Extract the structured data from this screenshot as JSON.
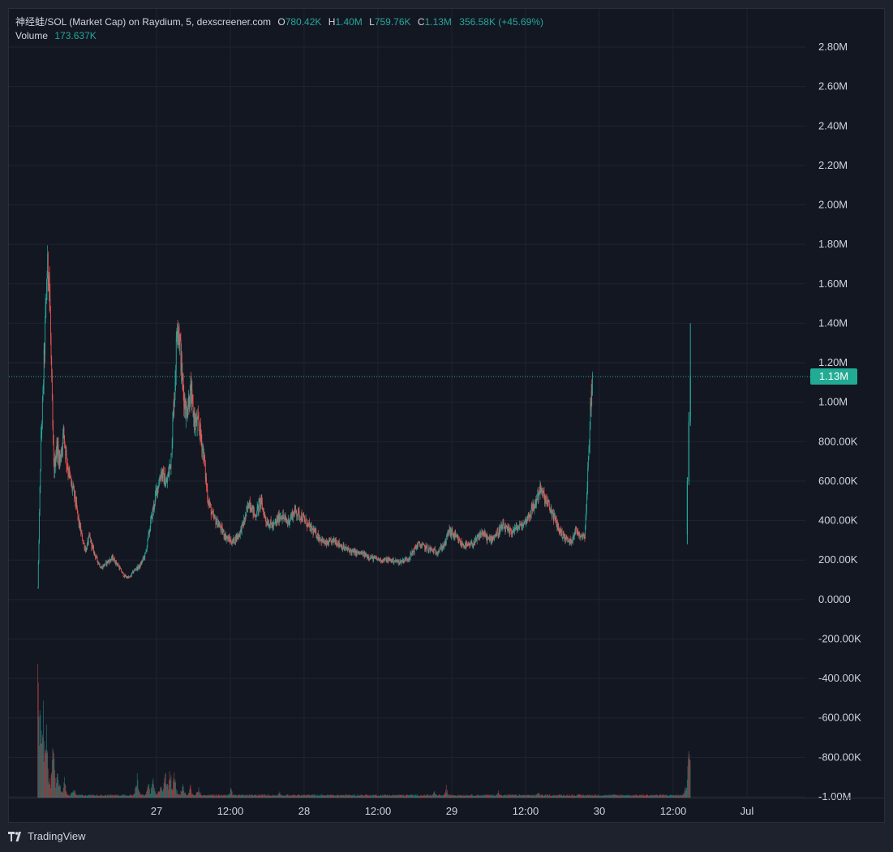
{
  "legend": {
    "symbol": "神经蛙/SOL (Market Cap) on Raydium, 5, dexscreener.com",
    "open_label": "O",
    "open": "780.42K",
    "high_label": "H",
    "high": "1.40M",
    "low_label": "L",
    "low": "759.76K",
    "close_label": "C",
    "close": "1.13M",
    "change": "356.58K (+45.69%)",
    "volume_label": "Volume",
    "volume": "173.637K"
  },
  "price_tag": "1.13M",
  "footer": {
    "brand": "TradingView"
  },
  "colors": {
    "background": "#131722",
    "grid": "#1f2430",
    "text": "#d1d4dc",
    "up": "#26a69a",
    "down": "#ef5350",
    "price_tag": "#22ab94"
  },
  "chart_data": {
    "type": "candlestick",
    "y_tick_labels": [
      "2.80M",
      "2.60M",
      "2.40M",
      "2.20M",
      "2.00M",
      "1.80M",
      "1.60M",
      "1.40M",
      "1.20M",
      "1.00M",
      "800.00K",
      "600.00K",
      "400.00K",
      "200.00K",
      "0.0000",
      "-200.00K",
      "-400.00K",
      "-600.00K",
      "-800.00K",
      "-1.00M"
    ],
    "y_tick_values": [
      2800000,
      2600000,
      2400000,
      2200000,
      2000000,
      1800000,
      1600000,
      1400000,
      1200000,
      1000000,
      800000,
      600000,
      400000,
      200000,
      0,
      -200000,
      -400000,
      -600000,
      -800000,
      -1000000
    ],
    "ylim": [
      -1000000,
      2800000
    ],
    "x_tick_labels": [
      "27",
      "12:00",
      "28",
      "12:00",
      "29",
      "12:00",
      "30",
      "12:00",
      "Jul"
    ],
    "x_tick_hours": [
      24,
      36,
      48,
      60,
      72,
      84,
      96,
      108,
      120
    ],
    "x_range_hours": [
      0,
      129.5
    ],
    "data_start_hour": 4.7,
    "data_end_hour": 110.8,
    "grid": true,
    "last_price": 1130000,
    "trajectory": [
      [
        4.7,
        60000
      ],
      [
        4.9,
        350000
      ],
      [
        5.2,
        800000
      ],
      [
        5.5,
        1000000
      ],
      [
        5.8,
        1300000
      ],
      [
        6.2,
        1650000
      ],
      [
        6.5,
        1700000
      ],
      [
        6.8,
        1300000
      ],
      [
        7.0,
        1000000
      ],
      [
        7.3,
        650000
      ],
      [
        7.8,
        780000
      ],
      [
        8.3,
        700000
      ],
      [
        8.9,
        850000
      ],
      [
        9.4,
        700000
      ],
      [
        10.0,
        600000
      ],
      [
        10.7,
        520000
      ],
      [
        11.3,
        400000
      ],
      [
        12.0,
        300000
      ],
      [
        12.5,
        250000
      ],
      [
        13.1,
        320000
      ],
      [
        13.6,
        260000
      ],
      [
        14.2,
        210000
      ],
      [
        15.0,
        160000
      ],
      [
        16.0,
        190000
      ],
      [
        16.9,
        210000
      ],
      [
        17.8,
        170000
      ],
      [
        18.7,
        120000
      ],
      [
        19.6,
        110000
      ],
      [
        20.4,
        150000
      ],
      [
        21.3,
        170000
      ],
      [
        22.2,
        230000
      ],
      [
        23.1,
        400000
      ],
      [
        24.0,
        550000
      ],
      [
        24.8,
        650000
      ],
      [
        25.6,
        580000
      ],
      [
        26.3,
        700000
      ],
      [
        27.0,
        1100000
      ],
      [
        27.4,
        1450000
      ],
      [
        27.8,
        1300000
      ],
      [
        28.2,
        1100000
      ],
      [
        28.8,
        950000
      ],
      [
        29.5,
        1050000
      ],
      [
        30.2,
        900000
      ],
      [
        30.9,
        880000
      ],
      [
        31.6,
        750000
      ],
      [
        32.3,
        520000
      ],
      [
        33.1,
        420000
      ],
      [
        34.1,
        380000
      ],
      [
        35.2,
        320000
      ],
      [
        36.3,
        290000
      ],
      [
        37.4,
        330000
      ],
      [
        38.3,
        400000
      ],
      [
        39.1,
        500000
      ],
      [
        40.0,
        420000
      ],
      [
        40.9,
        500000
      ],
      [
        41.8,
        400000
      ],
      [
        43.0,
        370000
      ],
      [
        44.2,
        430000
      ],
      [
        45.3,
        390000
      ],
      [
        46.5,
        450000
      ],
      [
        47.6,
        420000
      ],
      [
        48.8,
        370000
      ],
      [
        50.0,
        330000
      ],
      [
        51.5,
        280000
      ],
      [
        53.0,
        300000
      ],
      [
        54.5,
        260000
      ],
      [
        56.0,
        240000
      ],
      [
        57.6,
        230000
      ],
      [
        59.1,
        210000
      ],
      [
        60.5,
        200000
      ],
      [
        62.0,
        200000
      ],
      [
        63.5,
        190000
      ],
      [
        65.0,
        210000
      ],
      [
        66.5,
        280000
      ],
      [
        68.0,
        260000
      ],
      [
        69.5,
        240000
      ],
      [
        70.9,
        280000
      ],
      [
        71.5,
        350000
      ],
      [
        72.5,
        320000
      ],
      [
        73.6,
        280000
      ],
      [
        74.7,
        270000
      ],
      [
        75.8,
        290000
      ],
      [
        76.9,
        340000
      ],
      [
        78.1,
        300000
      ],
      [
        79.2,
        330000
      ],
      [
        80.3,
        370000
      ],
      [
        81.4,
        340000
      ],
      [
        82.5,
        360000
      ],
      [
        83.6,
        380000
      ],
      [
        84.6,
        430000
      ],
      [
        85.5,
        480000
      ],
      [
        86.3,
        560000
      ],
      [
        87.0,
        520000
      ],
      [
        87.8,
        470000
      ],
      [
        88.6,
        420000
      ],
      [
        89.5,
        350000
      ],
      [
        90.5,
        310000
      ],
      [
        91.3,
        290000
      ],
      [
        92.1,
        350000
      ],
      [
        92.9,
        330000
      ],
      [
        93.6,
        320000
      ],
      [
        94.0,
        550000
      ],
      [
        94.3,
        780000
      ],
      [
        94.6,
        1000000
      ],
      [
        94.9,
        1130000
      ]
    ],
    "volume_spikes": [
      [
        4.8,
        930000
      ],
      [
        5.1,
        630000
      ],
      [
        5.6,
        550000
      ],
      [
        6.1,
        480000
      ],
      [
        7.2,
        330000
      ],
      [
        8.0,
        200000
      ],
      [
        9.0,
        120000
      ],
      [
        10.5,
        80000
      ],
      [
        20.9,
        150000
      ],
      [
        22.7,
        90000
      ],
      [
        23.4,
        130000
      ],
      [
        24.6,
        100000
      ],
      [
        25.5,
        200000
      ],
      [
        26.2,
        190000
      ],
      [
        26.9,
        170000
      ],
      [
        28.3,
        110000
      ],
      [
        29.5,
        80000
      ],
      [
        30.8,
        70000
      ],
      [
        36.1,
        60000
      ],
      [
        44.0,
        40000
      ],
      [
        69.2,
        40000
      ],
      [
        71.1,
        70000
      ],
      [
        79.6,
        50000
      ],
      [
        86.1,
        40000
      ],
      [
        110.6,
        390000
      ],
      [
        110.7,
        270000
      ]
    ]
  }
}
